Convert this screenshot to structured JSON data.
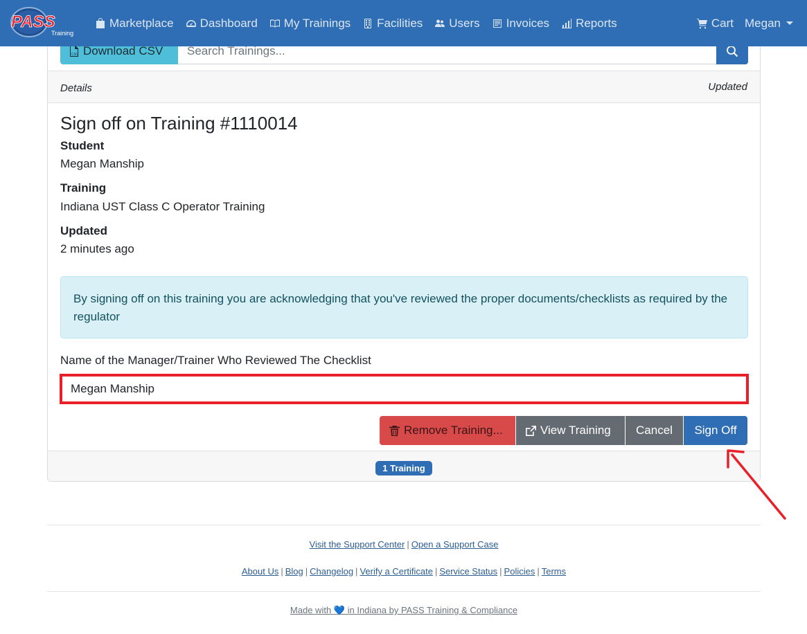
{
  "navbar": {
    "logo_text": "PASS",
    "logo_sub": "Training",
    "items": [
      {
        "label": "Marketplace",
        "icon": "shopping-bag-icon"
      },
      {
        "label": "Dashboard",
        "icon": "speedometer-icon"
      },
      {
        "label": "My Trainings",
        "icon": "book-icon"
      },
      {
        "label": "Facilities",
        "icon": "building-icon"
      },
      {
        "label": "Users",
        "icon": "users-icon"
      },
      {
        "label": "Invoices",
        "icon": "invoice-icon"
      },
      {
        "label": "Reports",
        "icon": "bar-chart-icon"
      }
    ],
    "cart_label": "Cart",
    "user_label": "Megan"
  },
  "toolbar": {
    "csv_label": "Download CSV",
    "search_placeholder": "Search Trainings..."
  },
  "details_bar": {
    "left": "Details",
    "right": "Updated"
  },
  "signoff": {
    "title": "Sign off on Training #1110014",
    "student_label": "Student",
    "student_value": "Megan Manship",
    "training_label": "Training",
    "training_value": "Indiana UST Class C Operator Training",
    "updated_label": "Updated",
    "updated_value": "2 minutes ago",
    "alert_text": "By signing off on this training you are acknowledging that you've reviewed the proper documents/checklists as required by the regulator",
    "input_label": "Name of the Manager/Trainer Who Reviewed The Checklist",
    "input_value": "Megan Manship"
  },
  "actions": {
    "remove_label": "Remove Training...",
    "view_label": "View Training",
    "cancel_label": "Cancel",
    "signoff_label": "Sign Off"
  },
  "card_footer": {
    "badge": "1 Training"
  },
  "footer": {
    "support_links": [
      "Visit the Support Center",
      "Open a Support Case"
    ],
    "links": [
      "About Us",
      "Blog",
      "Changelog",
      "Verify a Certificate",
      "Service Status",
      "Policies",
      "Terms"
    ],
    "made_with_prefix": "Made with",
    "made_with_suffix": "in Indiana by PASS Training & Compliance"
  },
  "colors": {
    "navbar": "#2f6eb5",
    "primary": "#2f6eb5",
    "danger": "#d84a4a",
    "secondary": "#646b72",
    "info_bg": "#d9f1f6",
    "highlight": "#e8202a"
  }
}
